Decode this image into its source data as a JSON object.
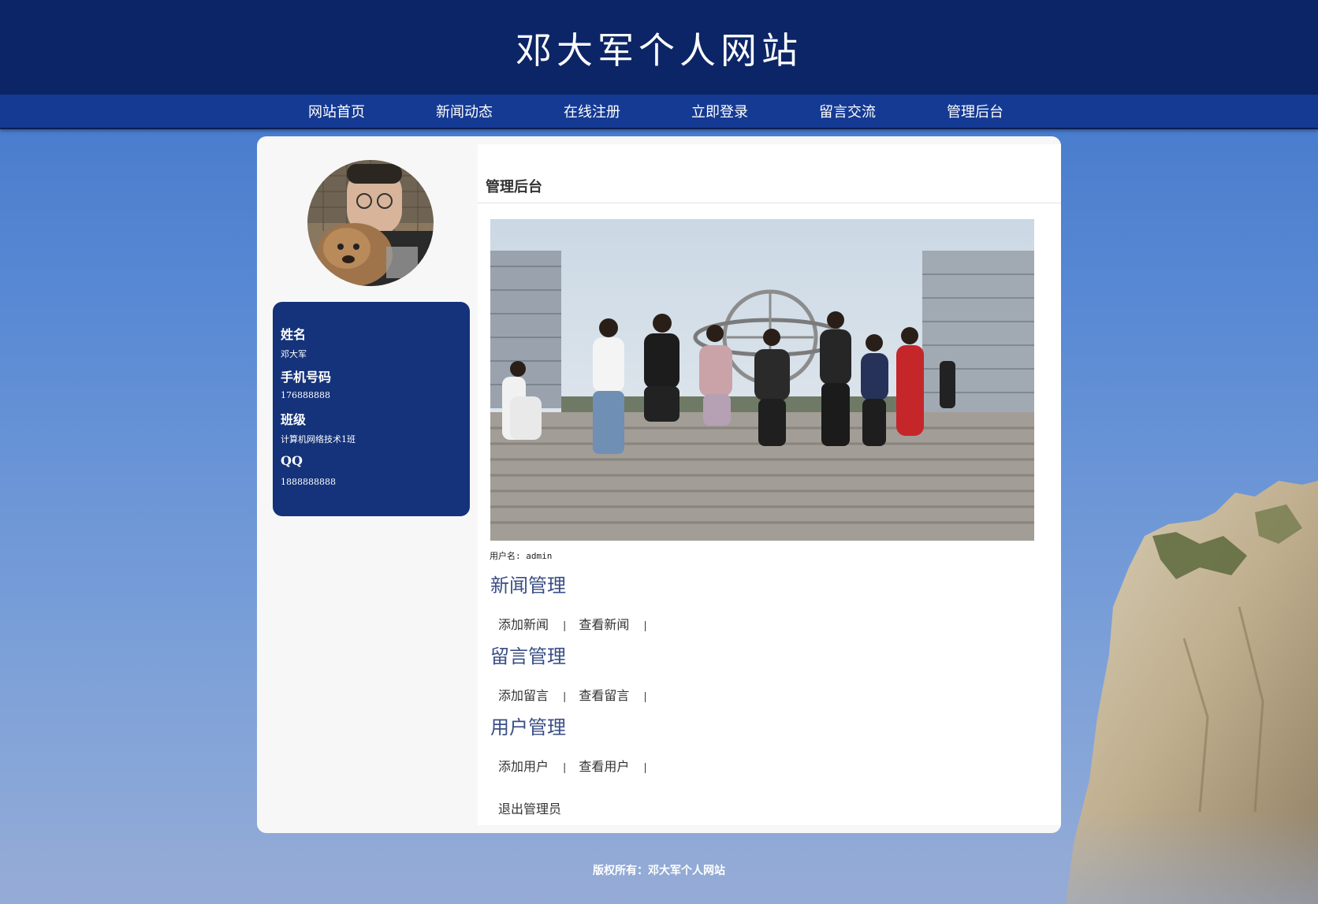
{
  "site": {
    "title": "邓大军个人网站"
  },
  "nav": [
    "网站首页",
    "新闻动态",
    "在线注册",
    "立即登录",
    "留言交流",
    "管理后台"
  ],
  "profile": {
    "name_label": "姓名",
    "name": "邓大军",
    "phone_label": "手机号码",
    "phone": "176888888",
    "class_label": "班级",
    "class": "计算机网络技术1班",
    "qq_label": "QQ",
    "qq": "1888888888"
  },
  "main": {
    "heading": "管理后台",
    "username": "用户名: admin",
    "sections": [
      {
        "title": "新闻管理",
        "links": [
          "添加新闻",
          "查看新闻"
        ]
      },
      {
        "title": "留言管理",
        "links": [
          "添加留言",
          "查看留言"
        ]
      },
      {
        "title": "用户管理",
        "links": [
          "添加用户",
          "查看用户"
        ]
      }
    ],
    "separator": "|",
    "logout": "退出管理员"
  },
  "footer": "版权所有：邓大军个人网站",
  "colors": {
    "header": "#0c2566",
    "nav": "#153a93",
    "card": "#15337a",
    "section_title": "#3a4e86"
  }
}
